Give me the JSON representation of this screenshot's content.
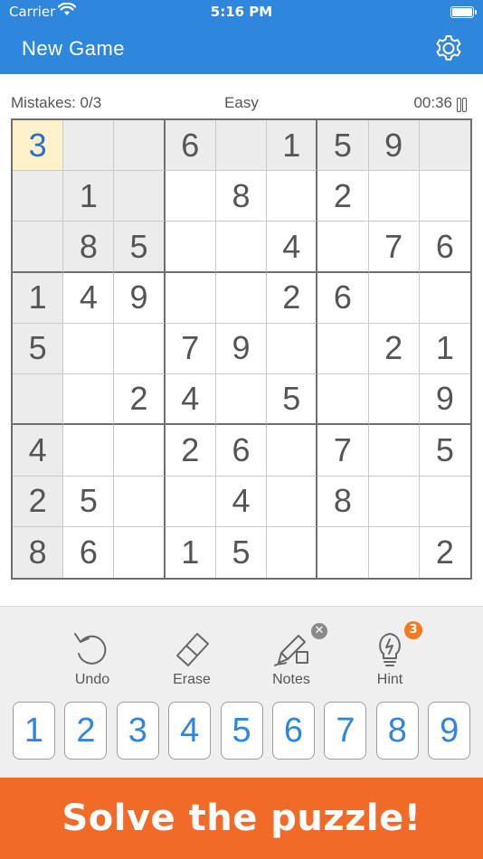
{
  "status_bar": {
    "carrier": "Carrier",
    "time": "5:16 PM"
  },
  "nav": {
    "title": "New Game",
    "settings_icon": "gear-icon"
  },
  "info": {
    "mistakes": "Mistakes: 0/3",
    "level": "Easy",
    "timer": "00:36"
  },
  "board": {
    "rows": [
      [
        "3",
        "",
        "",
        "6",
        "",
        "1",
        "5",
        "9",
        ""
      ],
      [
        "",
        "1",
        "",
        "",
        "8",
        "",
        "2",
        "",
        ""
      ],
      [
        "",
        "8",
        "5",
        "",
        "",
        "4",
        "",
        "7",
        "6"
      ],
      [
        "1",
        "4",
        "9",
        "",
        "",
        "2",
        "6",
        "",
        ""
      ],
      [
        "5",
        "",
        "",
        "7",
        "9",
        "",
        "",
        "2",
        "1"
      ],
      [
        "",
        "",
        "2",
        "4",
        "",
        "5",
        "",
        "",
        "9"
      ],
      [
        "4",
        "",
        "",
        "2",
        "6",
        "",
        "7",
        "",
        "5"
      ],
      [
        "2",
        "5",
        "",
        "",
        "4",
        "",
        "8",
        "",
        ""
      ],
      [
        "8",
        "6",
        "",
        "1",
        "5",
        "",
        "",
        "",
        "2"
      ]
    ],
    "selected": [
      0,
      0
    ],
    "colors": {
      "highlight": "#ececec",
      "selected": "#fcf1c9",
      "selected_text": "#2f6fc8",
      "given_text": "#555555"
    }
  },
  "tools": {
    "undo": {
      "label": "Undo",
      "icon": "undo-icon"
    },
    "erase": {
      "label": "Erase",
      "icon": "eraser-icon"
    },
    "notes": {
      "label": "Notes",
      "icon": "pencil-icon",
      "state_icon": "close-icon"
    },
    "hint": {
      "label": "Hint",
      "icon": "lightbulb-icon",
      "badge": "3"
    }
  },
  "numpad": [
    "1",
    "2",
    "3",
    "4",
    "5",
    "6",
    "7",
    "8",
    "9"
  ],
  "cta": {
    "label": "Solve the puzzle!"
  },
  "colors": {
    "primary": "#2f86dd",
    "accent": "#f26a28",
    "badge": "#f47a1f"
  }
}
